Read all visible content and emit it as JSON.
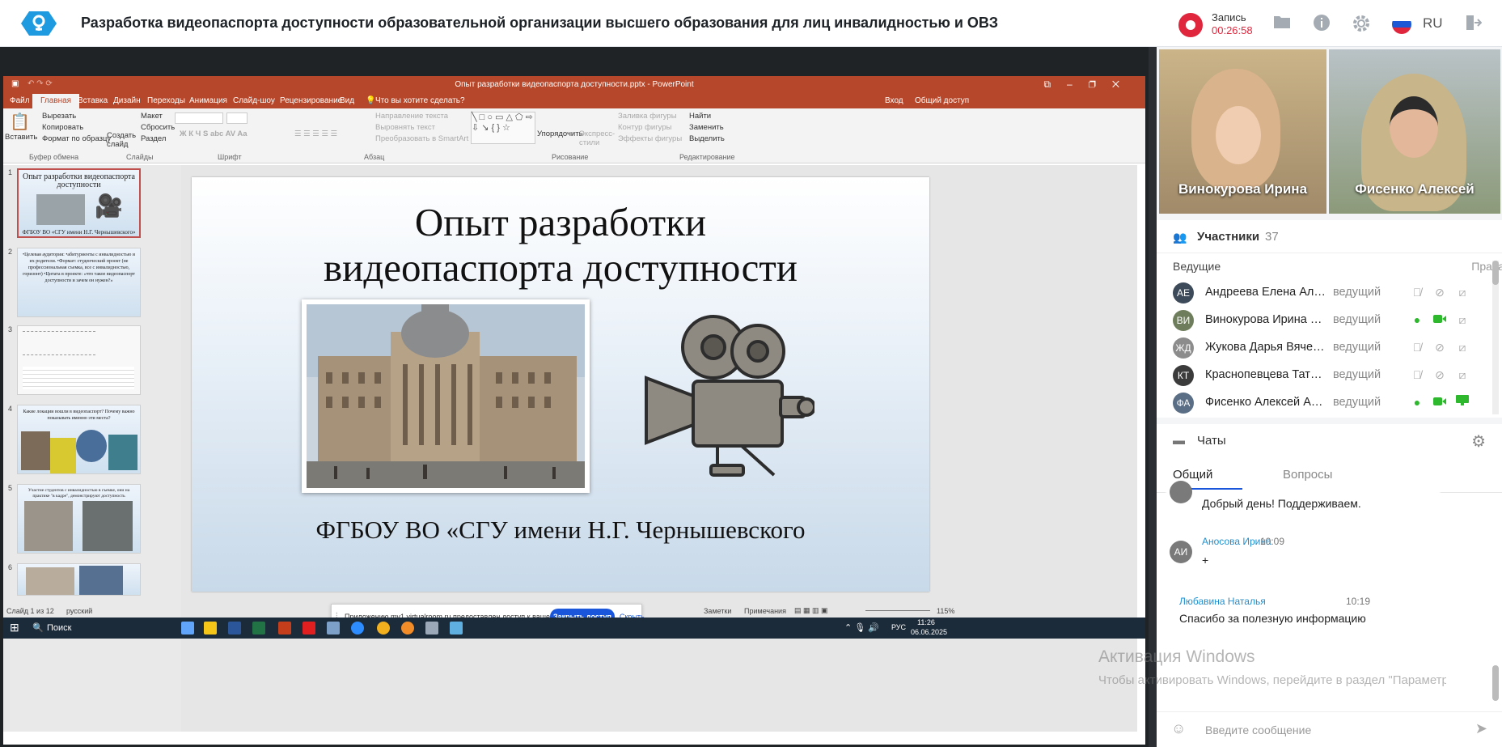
{
  "header": {
    "title": "Разработка видеопаспорта доступности образовательной организации высшего образования для лиц инвалидностью и ОВЗ",
    "record_label": "Запись",
    "record_time": "00:26:58",
    "language": "RU",
    "record_color": "#e0263c"
  },
  "powerpoint": {
    "window_title": "Опыт разработки видеопаспорта доступности.pptx - PowerPoint",
    "tabs": [
      "Файл",
      "Главная",
      "Вставка",
      "Дизайн",
      "Переходы",
      "Анимация",
      "Слайд-шоу",
      "Рецензирование",
      "Вид"
    ],
    "tell_me": "Что вы хотите сделать?",
    "login": "Вход",
    "share": "Общий доступ",
    "ribbon": {
      "paste": "Вставить",
      "cut": "Вырезать",
      "copy": "Копировать",
      "format_painter": "Формат по образцу",
      "new_slide": "Создать слайд",
      "layout": "Макет",
      "reset": "Сбросить",
      "section": "Раздел",
      "text_direction": "Направление текста",
      "align_text": "Выровнять текст",
      "smartart": "Преобразовать в SmartArt",
      "arrange": "Упорядочить",
      "quick_styles": "Экспресс-стили",
      "shape_fill": "Заливка фигуры",
      "shape_outline": "Контур фигуры",
      "shape_effects": "Эффекты фигуры",
      "find": "Найти",
      "replace": "Заменить",
      "select": "Выделить",
      "group_clipboard": "Буфер обмена",
      "group_slides": "Слайды",
      "group_font": "Шрифт",
      "group_paragraph": "Абзац",
      "group_drawing": "Рисование",
      "group_editing": "Редактирование"
    },
    "thumbnails": [
      {
        "num": "1",
        "text": "Опыт разработки видеопаспорта доступности",
        "caption": "ФГБОУ ВО «СГУ имени Н.Г. Чернышевского»"
      },
      {
        "num": "2",
        "text": "•Целевая аудитория: •абитуриенты с инвалидностью и их родители. •Формат: студенческий проект (не профессиональная съемка, все с инвалидностью, горизонт) •Цитата в проекте: «что такое видеопаспорт доступности и зачем он нужен?»"
      },
      {
        "num": "3",
        "text": ""
      },
      {
        "num": "4",
        "text": "Какие локации вошли в видеопаспорт? Почему важно показывать именно эти места?"
      },
      {
        "num": "5",
        "text": "Участие студентов с инвалидностью в съемке, они на практике \"в кадре\", демонстрируют доступность"
      },
      {
        "num": "6",
        "text": ""
      }
    ],
    "slide": {
      "title_line1": "Опыт разработки",
      "title_line2": "видеопаспорта доступности",
      "subtitle": "ФГБОУ ВО «СГУ имени Н.Г. Чернышевского"
    },
    "share_notice": {
      "text": "Приложению mv1.virtualroom.ru предоставлен доступ к вашему экрану.",
      "stop": "Закрыть доступ",
      "hide": "Скрыть"
    },
    "status": {
      "slide_count": "Слайд 1 из 12",
      "language": "русский",
      "notes": "Заметки",
      "comments": "Примечания",
      "zoom": "115%"
    }
  },
  "taskbar": {
    "search": "Поиск",
    "lang": "РУС",
    "time": "11:26",
    "date": "06.06.2025"
  },
  "videos": [
    {
      "name": "Винокурова Ирина"
    },
    {
      "name": "Фисенко Алексей"
    }
  ],
  "participants": {
    "title": "Участники",
    "count": "37",
    "section": "Ведущие",
    "rights": "Права",
    "list": [
      {
        "initials": "АЕ",
        "name": "Андреева Елена Алек...",
        "role": "ведущий",
        "color": "#3d4a59",
        "mic": false,
        "cam": false,
        "screen": false
      },
      {
        "initials": "ВИ",
        "name": "Винокурова Ирина Ви...",
        "role": "ведущий",
        "color": "#6e7d5b",
        "mic": true,
        "cam": true,
        "screen": false
      },
      {
        "initials": "ЖД",
        "name": "Жукова Дарья Вячесл...",
        "role": "ведущий",
        "color": "#8c8c8c",
        "mic": false,
        "cam": false,
        "screen": false
      },
      {
        "initials": "КТ",
        "name": "Краснопевцева Татья...",
        "role": "ведущий",
        "color": "#3b3b3b",
        "mic": false,
        "cam": false,
        "screen": false
      },
      {
        "initials": "ФА",
        "name": "Фисенко Алексей Ан...",
        "role": "ведущий",
        "color": "#5a6e85",
        "mic": true,
        "cam": true,
        "screen": true
      }
    ]
  },
  "chats": {
    "title": "Чаты",
    "tabs": [
      "Общий",
      "Вопросы"
    ],
    "messages": [
      {
        "author": "",
        "time": "",
        "text": "Добрый день! Поддерживаем."
      },
      {
        "initials": "АИ",
        "author": "Аносова Ирина",
        "time": "10:09",
        "text": "+"
      },
      {
        "author": "Любавина Наталья",
        "time": "10:19",
        "text": "Спасибо за полезную информацию"
      }
    ],
    "input_placeholder": "Введите сообщение"
  },
  "watermark": {
    "line1": "Активация Windows",
    "line2": "Чтобы активировать Windows, перейдите в раздел \"Параметры\"."
  }
}
